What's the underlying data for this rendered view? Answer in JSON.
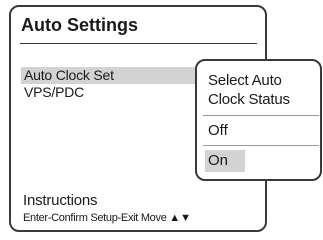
{
  "panel": {
    "title": "Auto Settings",
    "menu_items": [
      {
        "label": "Auto Clock Set",
        "selected": true
      },
      {
        "label": "VPS/PDC",
        "selected": false
      }
    ],
    "instructions_label": "Instructions",
    "instructions_text": "Enter-Confirm  Setup-Exit  Move",
    "arrow_icons": "▲▼"
  },
  "popup": {
    "prompt": "Select Auto\nClock Status",
    "prompt_line1": "Select Auto",
    "prompt_line2": "Clock Status",
    "options": [
      {
        "label": "Off",
        "selected": false
      },
      {
        "label": "On",
        "selected": true
      }
    ]
  },
  "colors": {
    "border": "#3a3a3a",
    "highlight": "#d3d3d3",
    "text": "#1a1a1a",
    "background": "#ffffff"
  }
}
